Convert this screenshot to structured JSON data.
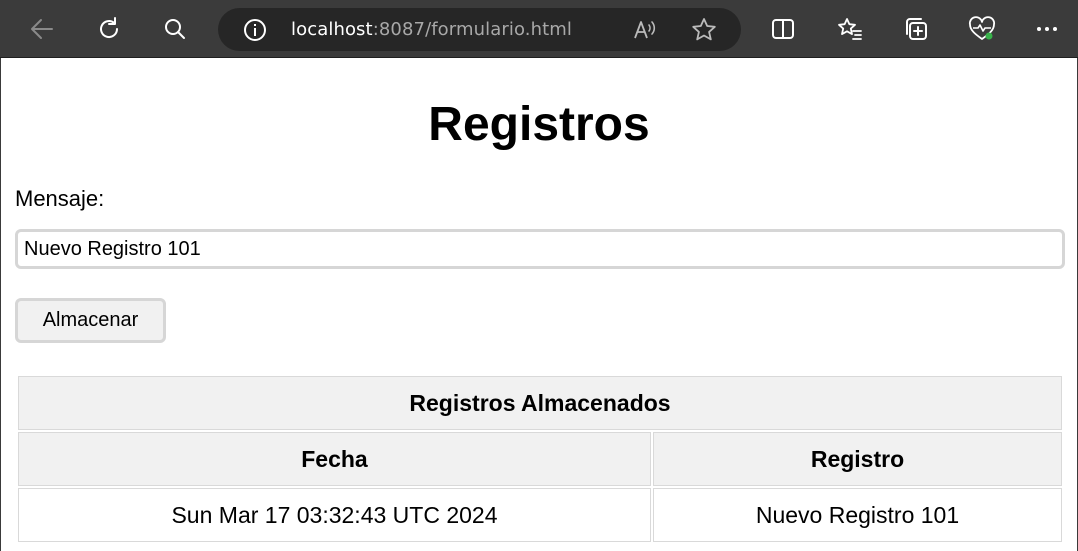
{
  "browser": {
    "url_host": "localhost",
    "url_rest": ":8087/formulario.html",
    "icons": [
      "back-icon",
      "refresh-icon",
      "search-icon",
      "info-icon",
      "read-aloud-icon",
      "favorite-star-icon",
      "split-screen-icon",
      "favorites-list-icon",
      "collections-icon",
      "browser-essentials-icon",
      "more-menu-icon"
    ]
  },
  "page": {
    "title": "Registros",
    "message_label": "Mensaje:",
    "message_value": "Nuevo Registro 101",
    "save_button": "Almacenar"
  },
  "table": {
    "caption": "Registros Almacenados",
    "headers": [
      "Fecha",
      "Registro"
    ],
    "rows": [
      [
        "Sun Mar 17 03:32:43 UTC 2024",
        "Nuevo Registro 101"
      ]
    ]
  }
}
